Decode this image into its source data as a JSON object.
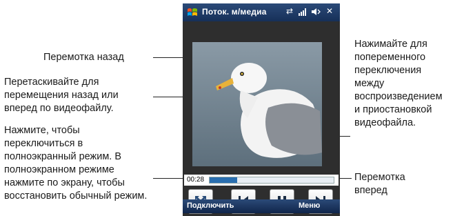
{
  "window": {
    "title": "Поток. м/медиа",
    "close_label": "✕"
  },
  "player": {
    "time": "00:28",
    "progress_fraction": 0.22
  },
  "softkeys": {
    "left": "Подключить",
    "right": "Меню"
  },
  "annotations": {
    "rewind": "Перемотка назад",
    "drag_line1": "Перетаскивайте для",
    "drag_line2": "перемещения назад или",
    "drag_line3": "вперед по видеофайлу.",
    "full_line1": "Нажмите, чтобы",
    "full_line2": "переключиться в",
    "full_line3": "полноэкранный режим. В",
    "full_line4": "полноэкранном режиме",
    "full_line5": "нажмите по экрану, чтобы",
    "full_line6": "восстановить обычный режим.",
    "play_line1": "Нажимайте для",
    "play_line2": "попеременного",
    "play_line3": "переключения",
    "play_line4": "между",
    "play_line5": "воспроизведением",
    "play_line6": "и приостановкой",
    "play_line7": "видеофайла.",
    "forward_line1": "Перемотка",
    "forward_line2": "вперед"
  },
  "icons": {
    "fullscreen": "fullscreen-icon",
    "previous": "skip-previous-icon",
    "pause": "pause-icon",
    "next": "skip-next-icon"
  }
}
